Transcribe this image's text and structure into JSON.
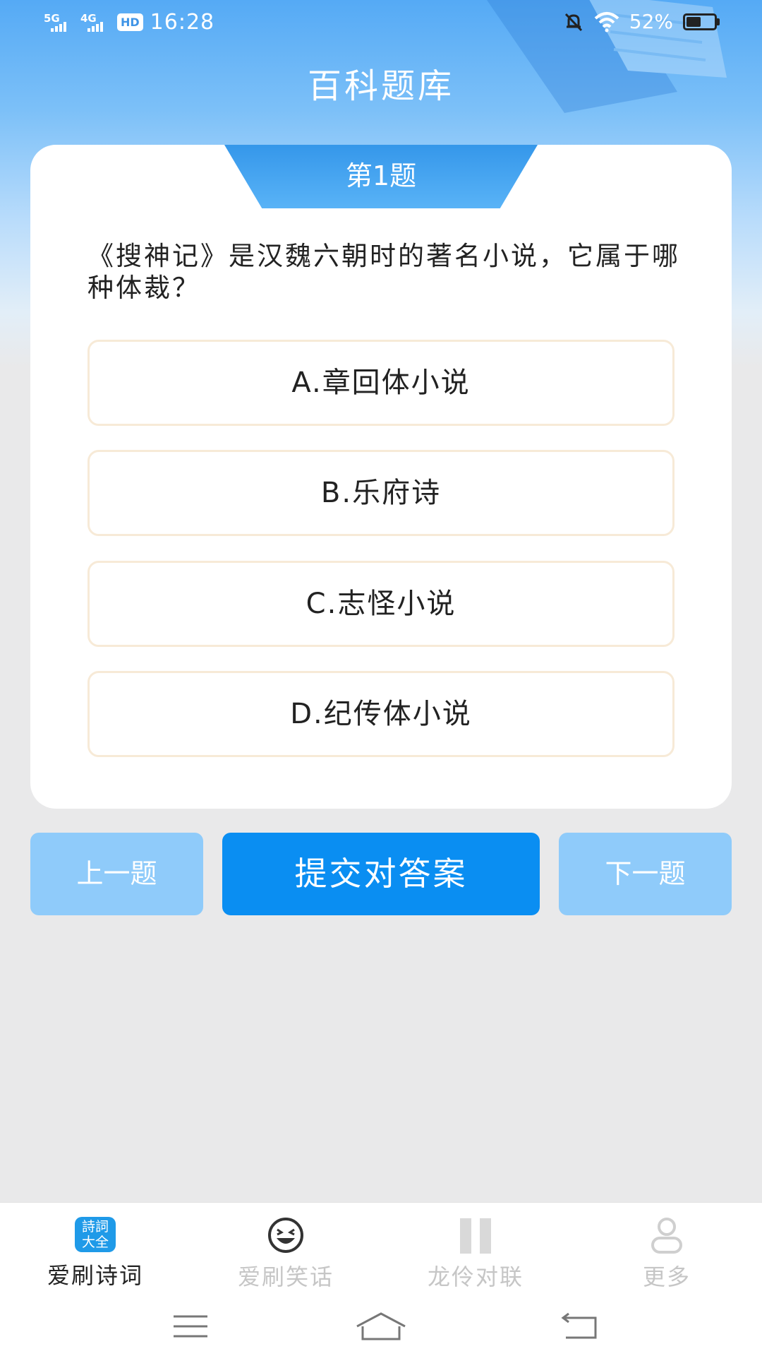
{
  "status_bar": {
    "network1": "5G",
    "network2": "4G",
    "hd": "HD",
    "time": "16:28",
    "battery_percent": "52%",
    "battery_level": 0.52
  },
  "header": {
    "title": "百科题库"
  },
  "quiz": {
    "question_number": "第1题",
    "question": "《搜神记》是汉魏六朝时的著名小说，它属于哪种体裁？",
    "options": [
      {
        "label": "A.章回体小说"
      },
      {
        "label": "B.乐府诗"
      },
      {
        "label": "C.志怪小说"
      },
      {
        "label": "D.纪传体小说"
      }
    ]
  },
  "actions": {
    "prev": "上一题",
    "submit": "提交对答案",
    "next": "下一题"
  },
  "tabbar": {
    "items": [
      {
        "label": "爱刷诗词",
        "icon": "poem-book-icon",
        "active": true,
        "icon_text": "詩詞大全"
      },
      {
        "label": "爱刷笑话",
        "icon": "laugh-face-icon",
        "active": false
      },
      {
        "label": "龙伶对联",
        "icon": "couplet-icon",
        "active": false
      },
      {
        "label": "更多",
        "icon": "person-icon",
        "active": false
      }
    ]
  },
  "colors": {
    "primary": "#0a8ef2",
    "secondary_button": "#8fcbfa",
    "header_gradient_top": "#55aaf5",
    "option_border": "#f7ead7"
  }
}
